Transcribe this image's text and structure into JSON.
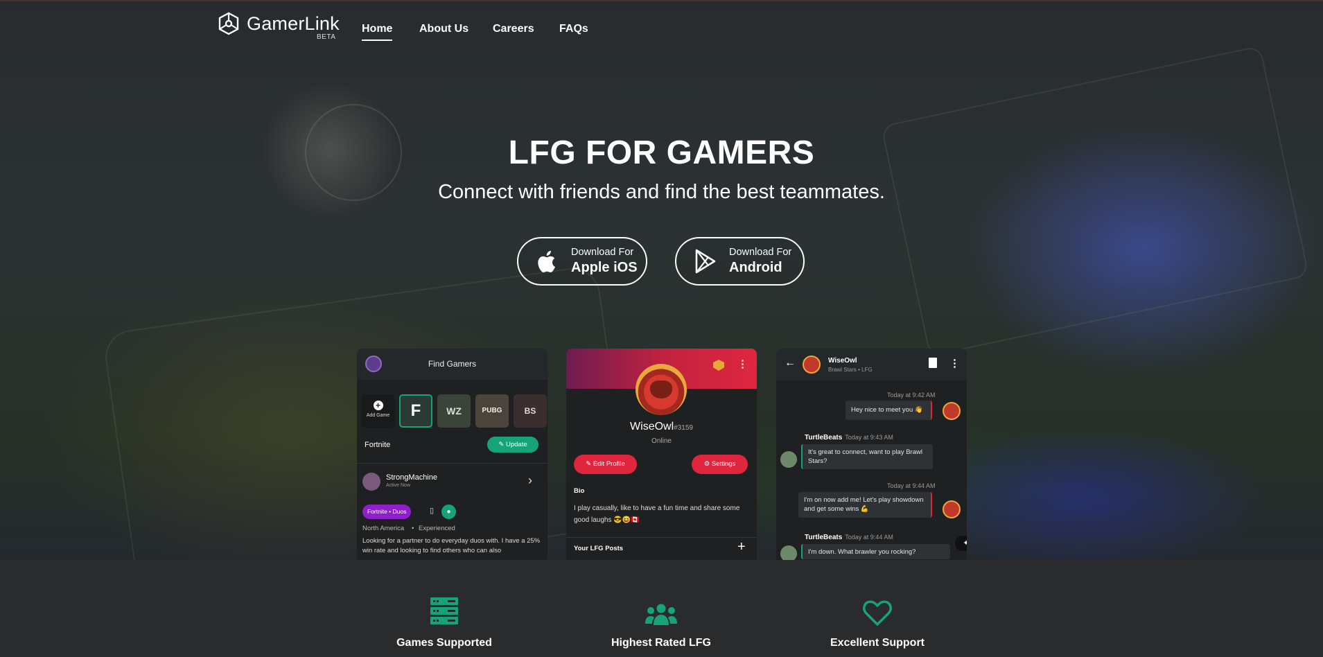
{
  "brand": {
    "name": "GamerLink",
    "badge": "BETA"
  },
  "nav": {
    "home": "Home",
    "about": "About Us",
    "careers": "Careers",
    "faqs": "FAQs"
  },
  "hero": {
    "title": "LFG FOR GAMERS",
    "subtitle": "Connect with friends and find the best teammates."
  },
  "downloads": {
    "ios": {
      "small": "Download For",
      "big": "Apple iOS"
    },
    "android": {
      "small": "Download For",
      "big": "Android"
    }
  },
  "find_gamers": {
    "title": "Find Gamers",
    "add_game": "Add Game",
    "games": [
      "F",
      "WZ",
      "PUBG",
      "BS"
    ],
    "selected_game": "Fortnite",
    "update_button": "Update",
    "player": {
      "name": "StrongMachine",
      "status": "Active Now",
      "tag": "Fortnite • Duos",
      "region": "North America",
      "level": "Experienced",
      "description": "Looking for a partner to do everyday duos with. I have a 25% win rate and looking to find others who can also"
    }
  },
  "profile": {
    "username": "WiseOwl",
    "discriminator": "#3159",
    "status": "Online",
    "edit_button": "Edit Profile",
    "settings_button": "Settings",
    "bio_label": "Bio",
    "bio": "I play casually, like to have a fun time and share some good laughs 😎😆🇨🇦",
    "lfg_posts_label": "Your LFG Posts"
  },
  "chat": {
    "name": "WiseOwl",
    "subtitle": "Brawl Stars • LFG",
    "messages": [
      {
        "time": "Today at 9:42 AM",
        "text": "Hey nice to meet you 👋"
      },
      {
        "sender": "TurtleBeats",
        "time": "Today at 9:43 AM",
        "text": "It's great to connect, want to play Brawl Stars?"
      },
      {
        "time": "Today at 9:44 AM",
        "text": "I'm on now add me! Let's play showdown and get some wins 💪"
      },
      {
        "sender": "TurtleBeats",
        "time": "Today at 9:44 AM",
        "text": "I'm down. What brawler you rocking?"
      }
    ]
  },
  "features": [
    {
      "label": "Games Supported",
      "icon": "server-icon"
    },
    {
      "label": "Highest Rated LFG",
      "icon": "users-icon"
    },
    {
      "label": "Excellent Support",
      "icon": "heart-icon"
    }
  ],
  "colors": {
    "accent": "#16a37a",
    "red": "#e0263f",
    "purple": "#8e1fc9",
    "background": "#292b2d"
  }
}
